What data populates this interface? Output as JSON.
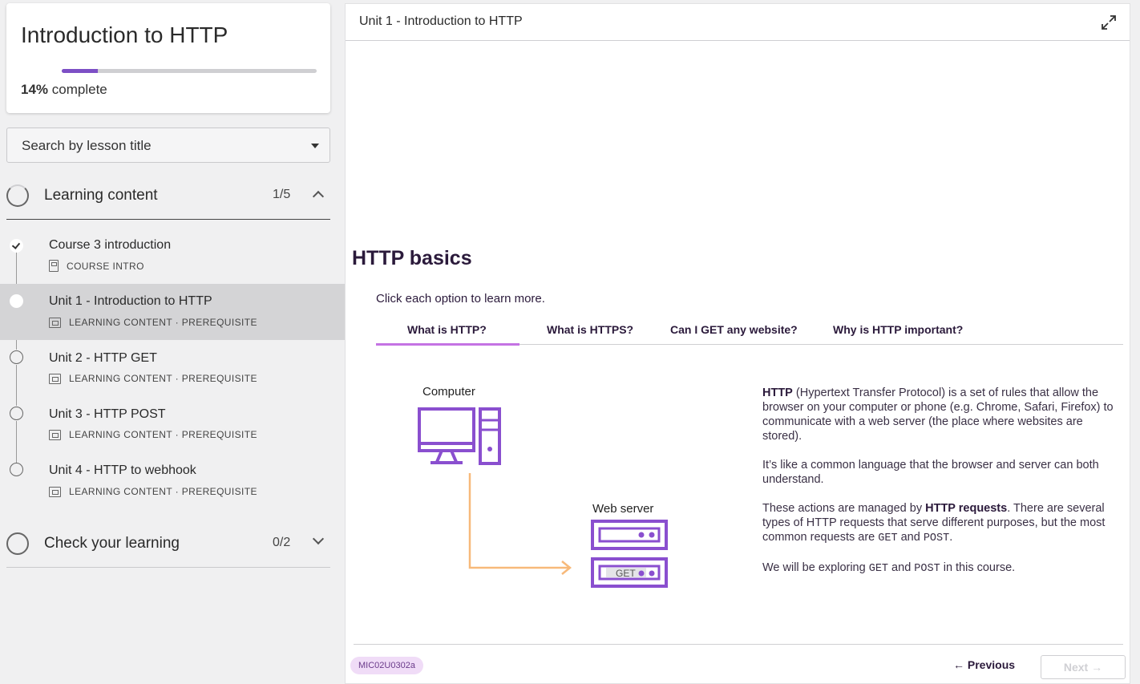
{
  "course": {
    "title": "Introduction to HTTP",
    "progress_percent": 14,
    "progress_label": "14%",
    "progress_suffix": "complete"
  },
  "search": {
    "placeholder": "Search by lesson title"
  },
  "sections": [
    {
      "title": "Learning content",
      "count": "1/5",
      "expanded": true
    },
    {
      "title": "Check your learning",
      "count": "0/2",
      "expanded": false
    }
  ],
  "lessons": [
    {
      "title": "Course 3 introduction",
      "meta": "COURSE INTRO",
      "status": "done"
    },
    {
      "title": "Unit 1 - Introduction to HTTP",
      "meta": "LEARNING CONTENT · PREREQUISITE",
      "status": "active"
    },
    {
      "title": "Unit 2 - HTTP GET",
      "meta": "LEARNING CONTENT · PREREQUISITE",
      "status": "todo"
    },
    {
      "title": "Unit 3 - HTTP POST",
      "meta": "LEARNING CONTENT · PREREQUISITE",
      "status": "todo"
    },
    {
      "title": "Unit 4 - HTTP to webhook",
      "meta": "LEARNING CONTENT · PREREQUISITE",
      "status": "todo"
    }
  ],
  "main": {
    "header_title": "Unit 1 - Introduction to HTTP",
    "heading": "HTTP basics",
    "instruction": "Click each option to learn more.",
    "tabs": [
      "What is HTTP?",
      "What is HTTPS?",
      "Can I GET any website?",
      "Why is HTTP important?"
    ],
    "active_tab": 0,
    "diagram": {
      "computer_label": "Computer",
      "server_label": "Web server",
      "request_label": "GET"
    },
    "description": {
      "p1_bold": "HTTP",
      "p1_rest": " (Hypertext Transfer Protocol) is a set of rules that allow the browser on your computer or phone (e.g. Chrome, Safari, Firefox) to communicate with a web server (the place where websites are stored).",
      "p2": "It’s like a common language that the browser and server can both understand.",
      "p3_a": "These actions are managed by ",
      "p3_bold": "HTTP requests",
      "p3_b": ". There are several types of HTTP requests that serve different purposes, but the most common requests are ",
      "p3_get": "GET",
      "p3_and": " and ",
      "p3_post": "POST",
      "p3_end": ".",
      "p4_a": "We will be exploring ",
      "p4_get": "GET",
      "p4_and": " and ",
      "p4_post": "POST",
      "p4_end": " in this course."
    },
    "footer": {
      "code": "MIC02U0302a",
      "previous": "← Previous",
      "next": "Next →"
    }
  },
  "colors": {
    "accent": "#7d4fc5",
    "tab_underline": "#c473e3",
    "arrow": "#f7b97a",
    "badge_bg": "#f0dcf7"
  }
}
